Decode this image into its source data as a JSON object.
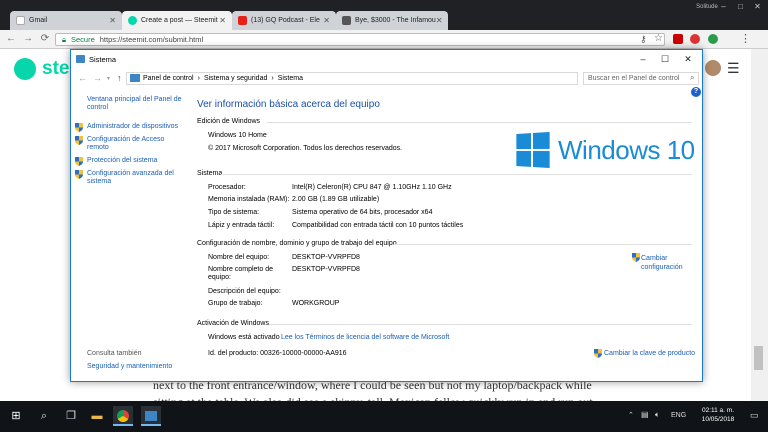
{
  "browser": {
    "user_label": "Solitude",
    "tabs": [
      {
        "title": "Gmail",
        "icon": "gmail-icon"
      },
      {
        "title": "Create a post — Steemit",
        "icon": "steemit-icon"
      },
      {
        "title": "(13) GQ Podcast - Ele",
        "icon": "youtube-icon"
      },
      {
        "title": "Bye, $3000 - The Infamou",
        "icon": "page-icon"
      }
    ],
    "secure_label": "Secure",
    "url": "https://steemit.com/submit.html",
    "colors": {
      "accent": "#1a73e8",
      "steemit": "#06d6a9"
    }
  },
  "page": {
    "logo_text": "stee",
    "article_text": "next to the front entrance/window, where I could be seen but not my laptop/backpack while sitting at the table. We also did see a skinny, tall, Mexican fellow quickly run in and run out"
  },
  "dialog": {
    "title": "Sistema",
    "breadcrumb": [
      "Panel de control",
      "Sistema y seguridad",
      "Sistema"
    ],
    "search_placeholder": "Buscar en el Panel de control",
    "sidebar": {
      "home": "Ventana principal del Panel de control",
      "links": [
        "Administrador de dispositivos",
        "Configuración de Acceso remoto",
        "Protección del sistema",
        "Configuración avanzada del sistema"
      ],
      "see_also_header": "Consulta también",
      "see_also_link": "Seguridad y mantenimiento"
    },
    "heading": "Ver información básica acerca del equipo",
    "edition": {
      "header": "Edición de Windows",
      "name": "Windows 10 Home",
      "copyright": "© 2017 Microsoft Corporation. Todos los derechos reservados.",
      "logo_text": "Windows 10"
    },
    "system": {
      "header": "Sistema",
      "rows": [
        {
          "label": "Procesador:",
          "value": "Intel(R) Celeron(R) CPU 847 @ 1.10GHz   1.10 GHz"
        },
        {
          "label": "Memoria instalada (RAM):",
          "value": "2.00 GB (1.89 GB utilizable)"
        },
        {
          "label": "Tipo de sistema:",
          "value": "Sistema operativo de 64 bits, procesador x64"
        },
        {
          "label": "Lápiz y entrada táctil:",
          "value": "Compatibilidad con entrada táctil con 10 puntos táctiles"
        }
      ]
    },
    "computer": {
      "header": "Configuración de nombre, dominio y grupo de trabajo del equipo",
      "rows": [
        {
          "label": "Nombre del equipo:",
          "value": "DESKTOP-VVRPFD8"
        },
        {
          "label": "Nombre completo de equipo:",
          "value": "DESKTOP-VVRPFD8"
        },
        {
          "label": "Descripción del equipo:",
          "value": ""
        },
        {
          "label": "Grupo de trabajo:",
          "value": "WORKGROUP"
        }
      ],
      "change_link": "Cambiar configuración"
    },
    "activation": {
      "header": "Activación de Windows",
      "status": "Windows está activado",
      "license_link": "Lee los Términos de licencia del software de Microsoft",
      "product_id": "Id. del producto: 00326-10000-00000-AA916",
      "change_key_link": "Cambiar la clave de producto"
    }
  },
  "taskbar": {
    "language": "ENG",
    "time": "02:11 a. m.",
    "date": "10/05/2018"
  }
}
